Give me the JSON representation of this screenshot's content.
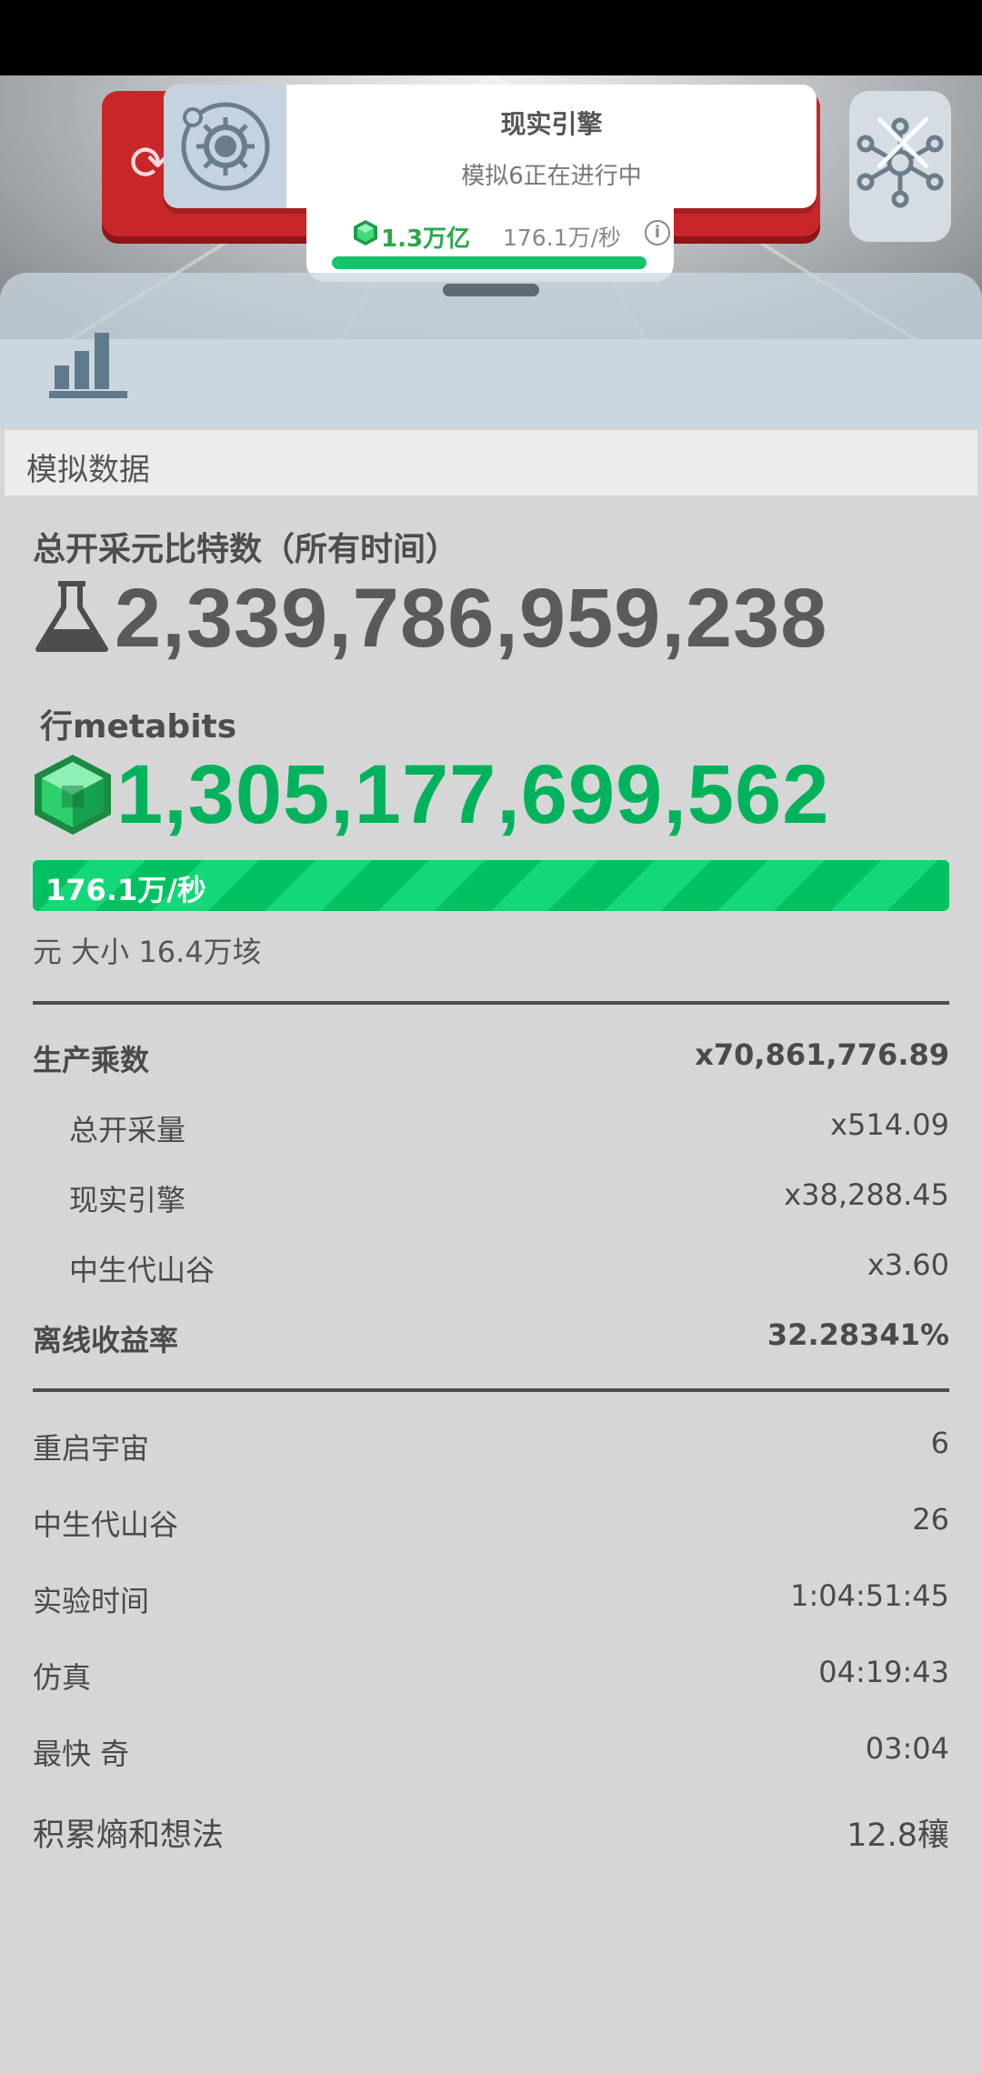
{
  "engine_card": {
    "title": "现实引擎",
    "subtitle": "模拟6正在进行中"
  },
  "currency_strip": {
    "amount": "1.3万亿",
    "rate": "176.1万/秒"
  },
  "section": {
    "title": "模拟数据"
  },
  "total_mined": {
    "label": "总开采元比特数（所有时间）",
    "value": "2,339,786,959,238"
  },
  "metabits": {
    "label": "行metabits",
    "value": "1,305,177,699,562",
    "rate": "176.1万/秒",
    "size": "元 大小 16.4万垓"
  },
  "multipliers": {
    "production": {
      "label": "生产乘数",
      "value": "x70,861,776.89"
    },
    "total_mined": {
      "label": "总开采量",
      "value": "x514.09"
    },
    "reality_engine": {
      "label": "现实引擎",
      "value": "x38,288.45"
    },
    "mesozoic_valley": {
      "label": "中生代山谷",
      "value": "x3.60"
    },
    "offline_rate": {
      "label": "离线收益率",
      "value": "32.28341%"
    }
  },
  "stats": {
    "rebooted": {
      "label": "重启宇宙",
      "value": "6"
    },
    "mesozoic": {
      "label": "中生代山谷",
      "value": "26"
    },
    "experiment_time": {
      "label": "实验时间",
      "value": "1:04:51:45"
    },
    "simulation": {
      "label": "仿真",
      "value": "04:19:43"
    },
    "fastest": {
      "label": "最快 奇",
      "value": "03:04"
    },
    "entropy": {
      "label": "积累熵和想法",
      "value": "12.8穰"
    }
  },
  "colors": {
    "green": "#00b25c",
    "dark_text": "#5a5a5a",
    "red": "#c9262a"
  }
}
